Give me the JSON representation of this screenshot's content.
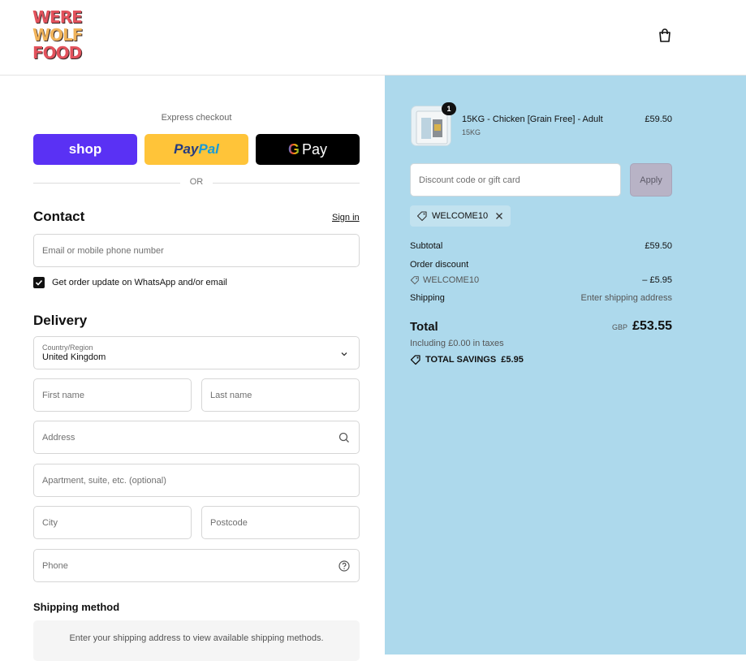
{
  "header": {
    "logo_lines": [
      "WERE",
      "WOLF",
      "FOOD"
    ],
    "bag_icon": "shopping-bag-icon"
  },
  "express": {
    "label": "Express checkout",
    "shop_label": "shop",
    "paypal_pay": "Pay",
    "paypal_pal": "Pal",
    "gpay_g": "G",
    "gpay_label": "Pay",
    "or_label": "OR"
  },
  "contact": {
    "title": "Contact",
    "signin": "Sign in",
    "email_placeholder": "Email or mobile phone number",
    "whatsapp_label": "Get order update on WhatsApp and/or email",
    "whatsapp_checked": true
  },
  "delivery": {
    "title": "Delivery",
    "country_label": "Country/Region",
    "country_value": "United Kingdom",
    "first_name": "First name",
    "last_name": "Last name",
    "address": "Address",
    "apartment": "Apartment, suite, etc. (optional)",
    "city": "City",
    "postcode": "Postcode",
    "phone": "Phone"
  },
  "shipping_method": {
    "title": "Shipping method",
    "message": "Enter your shipping address to view available shipping methods."
  },
  "summary": {
    "item": {
      "quantity": "1",
      "name": "15KG - Chicken [Grain Free] - Adult",
      "variant": "15KG",
      "price": "£59.50"
    },
    "discount_placeholder": "Discount code or gift card",
    "apply_label": "Apply",
    "applied_code": "WELCOME10",
    "subtotal_label": "Subtotal",
    "subtotal_value": "£59.50",
    "order_discount_label": "Order discount",
    "order_discount_code": "WELCOME10",
    "order_discount_value": "– £5.95",
    "shipping_label": "Shipping",
    "shipping_value": "Enter shipping address",
    "total_label": "Total",
    "total_currency": "GBP",
    "total_value": "£53.55",
    "taxes_text": "Including £0.00 in taxes",
    "savings_text": "TOTAL SAVINGS  £5.95"
  },
  "colors": {
    "summary_bg": "#add9ec",
    "shop_pay": "#5a31f4",
    "paypal": "#ffc439",
    "gpay": "#000000"
  }
}
